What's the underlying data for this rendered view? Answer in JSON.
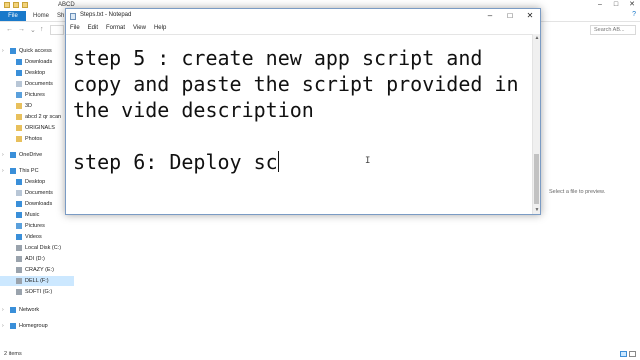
{
  "explorer": {
    "title": "ABCD",
    "ribbon_tabs": [
      "File",
      "Home",
      "Sh"
    ],
    "help": "?",
    "search_placeholder": "Search AB...",
    "sidebar": [
      {
        "label": "Quick access",
        "icon": "star-icon",
        "level": 0
      },
      {
        "label": "Downloads",
        "icon": "download-icon",
        "level": 1
      },
      {
        "label": "Desktop",
        "icon": "desktop-icon",
        "level": 1
      },
      {
        "label": "Documents",
        "icon": "documents-icon",
        "level": 1
      },
      {
        "label": "Pictures",
        "icon": "pictures-icon",
        "level": 1
      },
      {
        "label": "3D",
        "icon": "folder-icon",
        "level": 1
      },
      {
        "label": "abcd 2 qr scan",
        "icon": "folder-icon",
        "level": 1
      },
      {
        "label": "ORIGINALS",
        "icon": "folder-icon",
        "level": 1
      },
      {
        "label": "Photos",
        "icon": "folder-icon",
        "level": 1
      },
      {
        "label": "OneDrive",
        "icon": "cloud-icon",
        "level": 0
      },
      {
        "label": "This PC",
        "icon": "computer-icon",
        "level": 0
      },
      {
        "label": "Desktop",
        "icon": "desktop-icon",
        "level": 1
      },
      {
        "label": "Documents",
        "icon": "documents-icon",
        "level": 1
      },
      {
        "label": "Downloads",
        "icon": "download-icon",
        "level": 1
      },
      {
        "label": "Music",
        "icon": "music-icon",
        "level": 1
      },
      {
        "label": "Pictures",
        "icon": "pictures-icon",
        "level": 1
      },
      {
        "label": "Videos",
        "icon": "videos-icon",
        "level": 1
      },
      {
        "label": "Local Disk (C:)",
        "icon": "drive-icon",
        "level": 1
      },
      {
        "label": "ADI (D:)",
        "icon": "drive-icon",
        "level": 1
      },
      {
        "label": "CRAZY (E:)",
        "icon": "drive-icon",
        "level": 1
      },
      {
        "label": "DELL (F:)",
        "icon": "drive-icon",
        "level": 1,
        "selected": true
      },
      {
        "label": "SOFTI (G:)",
        "icon": "drive-icon",
        "level": 1
      },
      {
        "label": "Network",
        "icon": "network-icon",
        "level": 0
      },
      {
        "label": "Homegroup",
        "icon": "homegroup-icon",
        "level": 0
      }
    ],
    "preview_text": "Select a file to preview.",
    "status": "2 items"
  },
  "notepad": {
    "title": "Steps.txt - Notepad",
    "menus": [
      "File",
      "Edit",
      "Format",
      "View",
      "Help"
    ],
    "lines": [
      "step 5 : create new app script and",
      "copy and paste the script provided in",
      "the vide description",
      "",
      "step 6: Deploy sc"
    ]
  },
  "colors": {
    "ribbon_file_bg": "#1979ca",
    "selection_bg": "#cce8ff",
    "notepad_border": "#7a9bc4"
  }
}
